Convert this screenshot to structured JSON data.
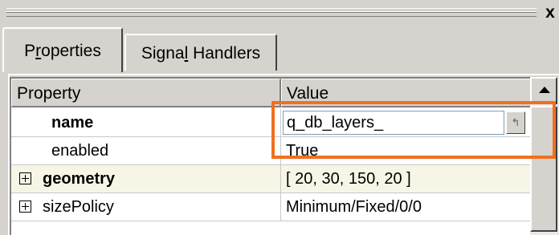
{
  "window": {
    "close_glyph": "x"
  },
  "tabs": [
    {
      "label_prefix": "P",
      "label_accel": "r",
      "label_suffix": "operties",
      "active": true
    },
    {
      "label_prefix": "Signa",
      "label_accel": "l",
      "label_suffix": " Handlers",
      "active": false
    }
  ],
  "table": {
    "headers": [
      "Property",
      "Value"
    ],
    "rows": [
      {
        "property": "name",
        "value": "q_db_layers_",
        "bold": true,
        "expandable": false,
        "editing": true
      },
      {
        "property": "enabled",
        "value": "True",
        "bold": false,
        "expandable": false
      },
      {
        "property": "geometry",
        "value": "[ 20, 30, 150, 20 ]",
        "bold": true,
        "expandable": true
      },
      {
        "property": "sizePolicy",
        "value": "Minimum/Fixed/0/0",
        "bold": false,
        "expandable": true
      }
    ]
  },
  "editor": {
    "button_icon": "reset-arrow-icon",
    "button_glyph": "↰"
  },
  "colors": {
    "highlight": "#f07020",
    "alt_row": "#f7f6e6"
  }
}
